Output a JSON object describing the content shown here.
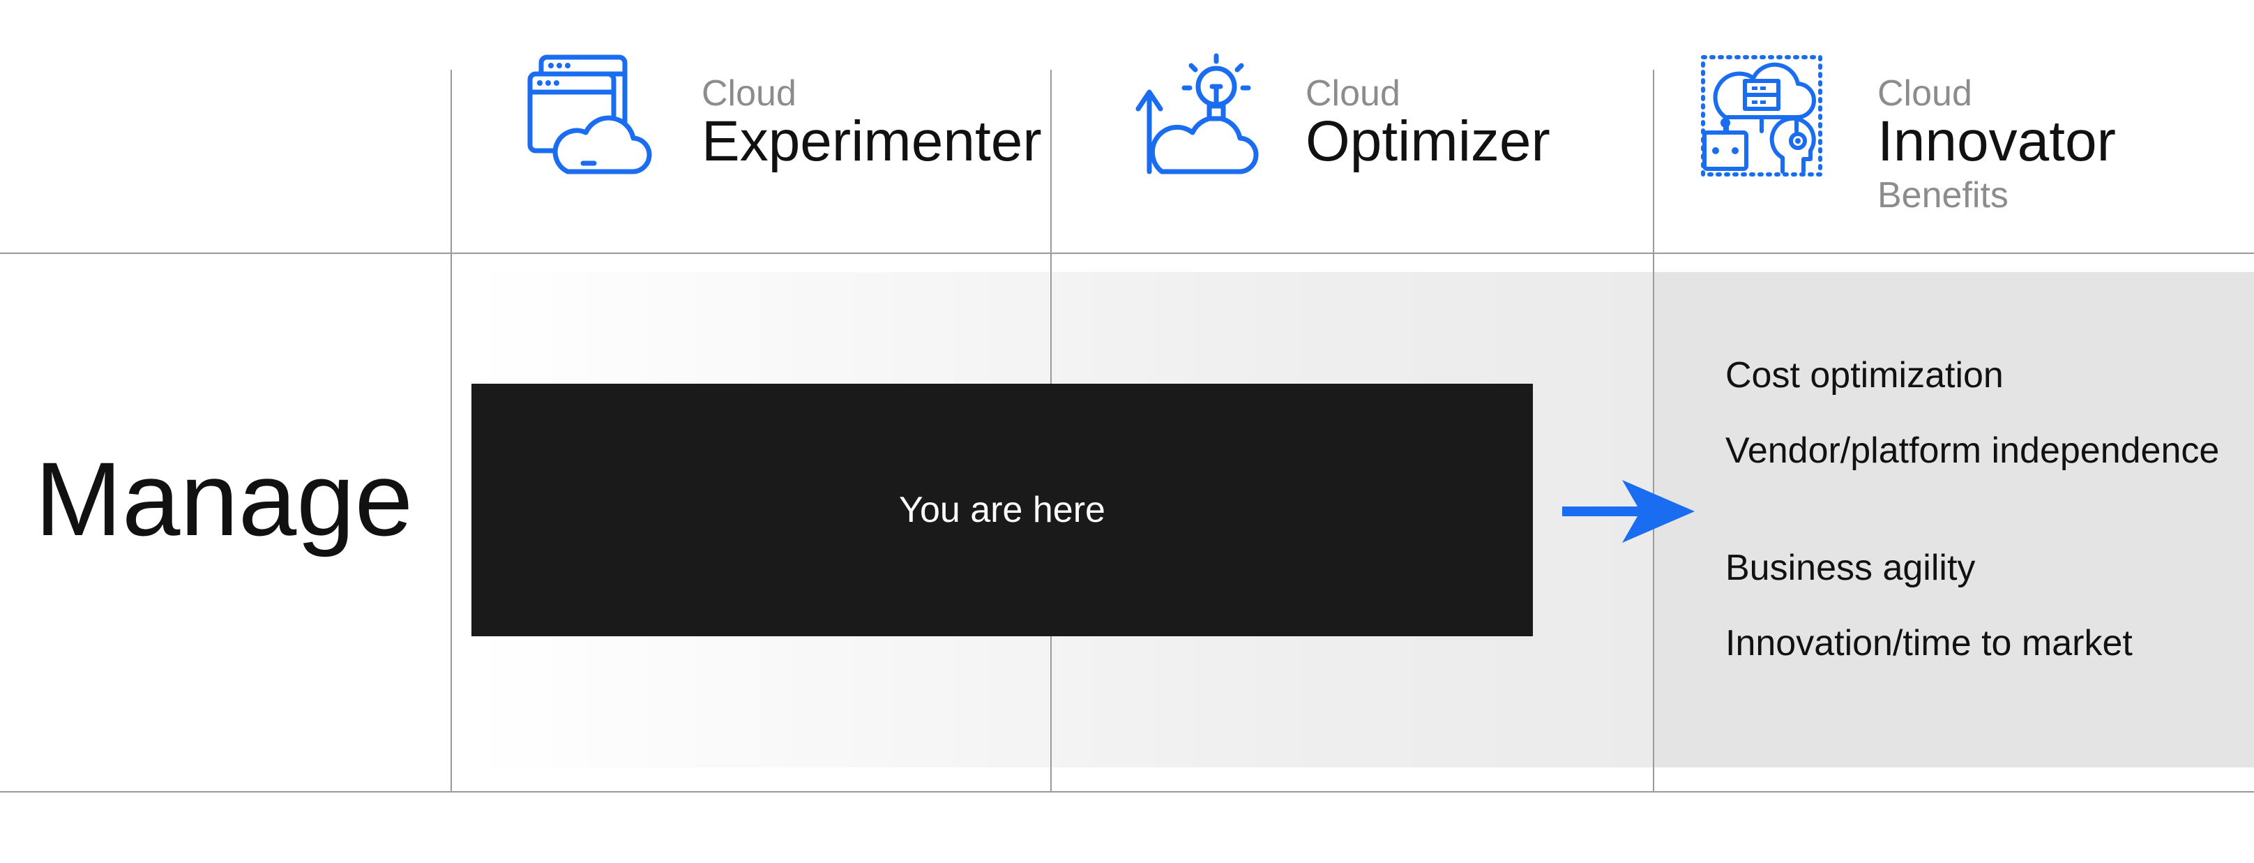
{
  "colors": {
    "accent": "#1a6cf0",
    "grid_line": "#9a9a9a",
    "marker_box": "#1a1a1a",
    "marker_text": "#ffffff",
    "muted_text": "#8c8c8c",
    "band_right": "#e4e4e4"
  },
  "stages": [
    {
      "prefix": "Cloud",
      "name": "Experimenter",
      "icon": "browser-cloud-icon"
    },
    {
      "prefix": "Cloud",
      "name": "Optimizer",
      "icon": "cloud-idea-growth-icon"
    },
    {
      "prefix": "Cloud",
      "name": "Innovator",
      "icon": "cloud-ai-robot-icon"
    }
  ],
  "benefits": {
    "heading": "Benefits",
    "items": [
      "Cost optimization",
      "Vendor/platform independence",
      "Business agility",
      "Innovation/time to market"
    ]
  },
  "row": {
    "label": "Manage"
  },
  "marker": {
    "text": "You are here"
  },
  "arrow": {
    "icon": "arrow-right-icon"
  }
}
